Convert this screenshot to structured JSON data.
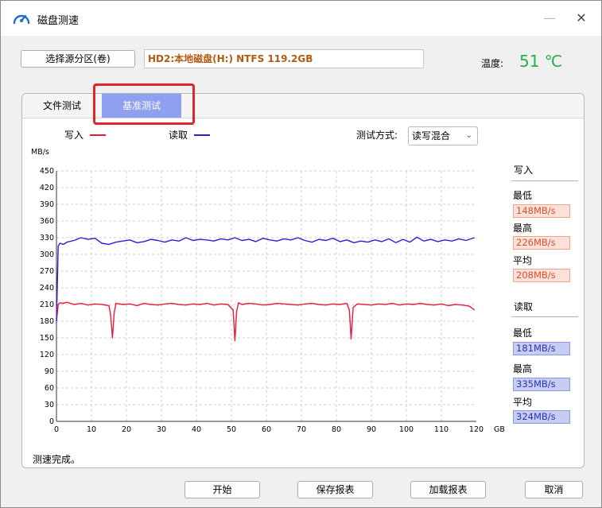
{
  "window": {
    "title": "磁盘测速",
    "minimize": "—",
    "maximize": "☐",
    "close": "✕"
  },
  "toolbar": {
    "select_partition_label": "选择源分区(卷)",
    "partition_value": "HD2:本地磁盘(H:) NTFS 119.2GB",
    "temperature_label": "温度:",
    "temperature_value": "51 ℃"
  },
  "tabs": [
    {
      "label": "文件测试",
      "active": false
    },
    {
      "label": "基准测试",
      "active": true
    }
  ],
  "legend": {
    "write": "写入",
    "read": "读取"
  },
  "test_mode": {
    "label": "测试方式:",
    "value": "读写混合"
  },
  "stats": {
    "write": {
      "heading": "写入",
      "min_label": "最低",
      "min": "148MB/s",
      "max_label": "最高",
      "max": "226MB/s",
      "avg_label": "平均",
      "avg": "208MB/s"
    },
    "read": {
      "heading": "读取",
      "min_label": "最低",
      "min": "181MB/s",
      "max_label": "最高",
      "max": "335MB/s",
      "avg_label": "平均",
      "avg": "324MB/s"
    }
  },
  "status": "测速完成。",
  "buttons": {
    "start": "开始",
    "save": "保存报表",
    "load": "加载报表",
    "cancel": "取消"
  },
  "colors": {
    "write": "#e8193c",
    "read": "#3b17d6",
    "accent_tab": "#8fa0f0",
    "temperature": "#22b14c"
  },
  "chart_data": {
    "type": "line",
    "ylabel": "MB/s",
    "xlabel": "GB",
    "xlim": [
      0,
      120
    ],
    "ylim": [
      0,
      450
    ],
    "xticks": [
      0,
      10,
      20,
      30,
      40,
      50,
      60,
      70,
      80,
      90,
      100,
      110,
      120
    ],
    "yticks": [
      0,
      30,
      60,
      90,
      120,
      150,
      180,
      210,
      240,
      270,
      300,
      330,
      360,
      390,
      420,
      450
    ],
    "grid": true,
    "series": [
      {
        "name": "写入",
        "x": [
          0,
          0.5,
          1,
          2,
          3,
          5,
          7,
          9,
          11,
          13,
          15,
          15.5,
          16,
          16.5,
          17,
          19,
          21,
          23,
          25,
          27,
          29,
          31,
          33,
          35,
          37,
          39,
          41,
          43,
          45,
          47,
          49,
          50.5,
          51,
          51.5,
          52,
          53,
          55,
          57,
          59,
          61,
          63,
          65,
          67,
          69,
          71,
          73,
          75,
          77,
          79,
          81,
          83,
          83.7,
          84.2,
          84.8,
          86,
          88,
          90,
          92,
          94,
          96,
          98,
          100,
          102,
          104,
          106,
          108,
          110,
          112,
          114,
          116,
          118,
          119.5
        ],
        "values": [
          180,
          210,
          213,
          212,
          214,
          210,
          212,
          209,
          211,
          210,
          208,
          190,
          150,
          195,
          212,
          210,
          211,
          208,
          212,
          210,
          209,
          211,
          212,
          210,
          209,
          211,
          210,
          212,
          209,
          211,
          210,
          200,
          145,
          198,
          213,
          210,
          212,
          211,
          209,
          210,
          212,
          211,
          210,
          209,
          211,
          212,
          210,
          209,
          211,
          210,
          212,
          200,
          148,
          205,
          211,
          210,
          209,
          211,
          210,
          212,
          209,
          211,
          210,
          212,
          210,
          209,
          211,
          208,
          210,
          209,
          207,
          200
        ]
      },
      {
        "name": "读取",
        "x": [
          0,
          0.5,
          1,
          2,
          3,
          5,
          7,
          9,
          11,
          13,
          15,
          17,
          19,
          21,
          23,
          25,
          27,
          29,
          31,
          33,
          35,
          37,
          39,
          41,
          43,
          45,
          47,
          49,
          51,
          53,
          55,
          57,
          59,
          61,
          63,
          65,
          67,
          69,
          71,
          73,
          75,
          77,
          79,
          81,
          83,
          85,
          87,
          89,
          91,
          93,
          95,
          97,
          99,
          101,
          103,
          105,
          107,
          109,
          111,
          113,
          115,
          117,
          119.5
        ],
        "values": [
          180,
          315,
          320,
          318,
          322,
          325,
          330,
          327,
          329,
          320,
          318,
          322,
          324,
          326,
          321,
          323,
          327,
          325,
          322,
          326,
          324,
          330,
          325,
          327,
          326,
          324,
          328,
          326,
          330,
          325,
          327,
          323,
          329,
          326,
          324,
          328,
          326,
          330,
          325,
          322,
          327,
          325,
          329,
          323,
          326,
          321,
          324,
          322,
          326,
          323,
          328,
          321,
          327,
          322,
          331,
          324,
          327,
          323,
          326,
          324,
          328,
          325,
          330
        ]
      }
    ]
  }
}
